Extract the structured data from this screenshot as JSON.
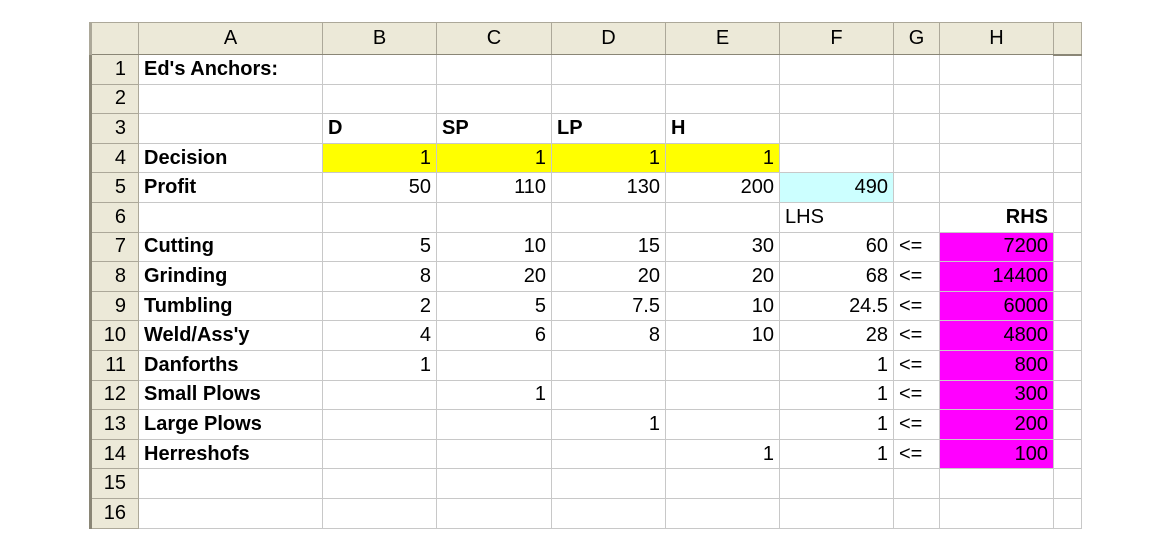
{
  "columns": [
    "A",
    "B",
    "C",
    "D",
    "E",
    "F",
    "G",
    "H",
    ""
  ],
  "rows": {
    "r1": {
      "num": "1",
      "A": "Ed's Anchors:"
    },
    "r2": {
      "num": "2"
    },
    "r3": {
      "num": "3",
      "B": "D",
      "C": "SP",
      "D": "LP",
      "E": "H"
    },
    "r4": {
      "num": "4",
      "A": "Decision",
      "B": "1",
      "C": "1",
      "D": "1",
      "E": "1"
    },
    "r5": {
      "num": "5",
      "A": "Profit",
      "B": "50",
      "C": "110",
      "D": "130",
      "E": "200",
      "F": "490"
    },
    "r6": {
      "num": "6",
      "F": "LHS",
      "H": "RHS"
    },
    "r7": {
      "num": "7",
      "A": "Cutting",
      "B": "5",
      "C": "10",
      "D": "15",
      "E": "30",
      "F": "60",
      "G": "<=",
      "H": "7200"
    },
    "r8": {
      "num": "8",
      "A": "Grinding",
      "B": "8",
      "C": "20",
      "D": "20",
      "E": "20",
      "F": "68",
      "G": "<=",
      "H": "14400"
    },
    "r9": {
      "num": "9",
      "A": "Tumbling",
      "B": "2",
      "C": "5",
      "D": "7.5",
      "E": "10",
      "F": "24.5",
      "G": "<=",
      "H": "6000"
    },
    "r10": {
      "num": "10",
      "A": "Weld/Ass'y",
      "B": "4",
      "C": "6",
      "D": "8",
      "E": "10",
      "F": "28",
      "G": "<=",
      "H": "4800"
    },
    "r11": {
      "num": "11",
      "A": "Danforths",
      "B": "1",
      "F": "1",
      "G": "<=",
      "H": "800"
    },
    "r12": {
      "num": "12",
      "A": "Small Plows",
      "C": "1",
      "F": "1",
      "G": "<=",
      "H": "300"
    },
    "r13": {
      "num": "13",
      "A": "Large Plows",
      "D": "1",
      "F": "1",
      "G": "<=",
      "H": "200"
    },
    "r14": {
      "num": "14",
      "A": "Herreshofs",
      "E": "1",
      "F": "1",
      "G": "<=",
      "H": "100"
    },
    "r15": {
      "num": "15"
    },
    "r16": {
      "num": "16"
    }
  },
  "colors": {
    "decision_fill": "#ffff00",
    "objective_fill": "#ccffff",
    "rhs_fill": "#ff00ff",
    "header_bg": "#ece9d8",
    "selected_column_header": "#ffc37a"
  }
}
